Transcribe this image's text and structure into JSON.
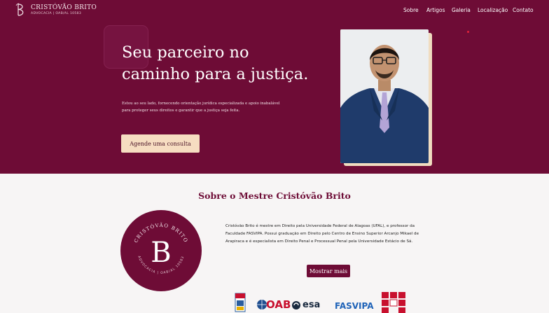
{
  "nav": {
    "brand_name": "CRISTÓVÃO BRITO",
    "brand_subtitle": "ADVOCACIA | OAB/AL 10583",
    "links": [
      "Sobre",
      "Artigos",
      "Galeria",
      "Localização",
      "Contato"
    ]
  },
  "hero": {
    "title_line1": "Seu parceiro no",
    "title_line2": "caminho para a justiça.",
    "text": "Estou ao seu lado, fornecendo orientação jurídica especializada e apoio inabalável para proteger seus direitos e garantir que a justiça seja feita.",
    "cta_label": "Agende uma consulta"
  },
  "about": {
    "title": "Sobre o Mestre Cristóvão Brito",
    "emblem_letter": "B",
    "emblem_top_text": "CRISTÓVÃO BRITO",
    "emblem_bottom_text": "ADVOCACIA | OAB/AL 10583",
    "text": "Cristóvão Brito é mestre em Direito pela Universidade Federal de Alagoas (UFAL), e professor da Faculdade FASVIPA. Possui graduação em Direito pelo Centro de Ensino Superior Arcanjo Mikael de Arapiraca e é especialista em Direito Penal e Processual Penal pela Universidade Estácio de Sá.",
    "more_label": "Mostrar mais"
  },
  "partners": {
    "oab": "OAB",
    "esa": "esa",
    "fasvipa": "FASVIPA"
  },
  "colors": {
    "brand": "#6e0c36",
    "cta": "#f6ddc1",
    "background": "#f7f5f5"
  }
}
